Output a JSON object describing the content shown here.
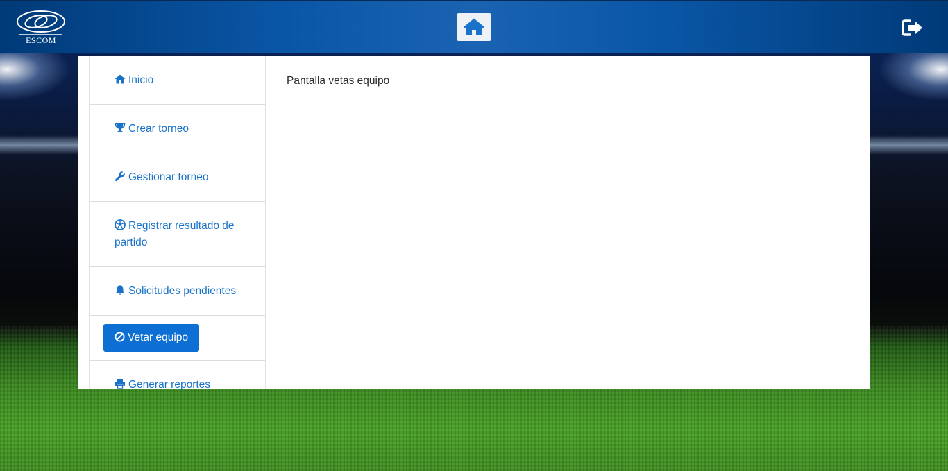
{
  "header": {
    "logo_text": "ESCOM",
    "home_icon": "home-icon",
    "logout_icon": "sign-out-icon"
  },
  "sidebar": {
    "items": [
      {
        "label": "Inicio",
        "icon": "home-icon"
      },
      {
        "label": "Crear torneo",
        "icon": "trophy-icon"
      },
      {
        "label": "Gestionar torneo",
        "icon": "wrench-icon"
      },
      {
        "label": "Registrar resultado de partido",
        "icon": "soccer-ball-icon"
      },
      {
        "label": "Solicitudes pendientes",
        "icon": "bell-icon"
      },
      {
        "label": "Vetar equipo",
        "icon": "ban-icon",
        "active": true
      },
      {
        "label": "Generar reportes",
        "icon": "print-icon"
      }
    ]
  },
  "main": {
    "text": "Pantalla vetas equipo"
  },
  "colors": {
    "accent": "#0d6fd4",
    "link": "#1a73c9",
    "header": "#0a56a6"
  }
}
